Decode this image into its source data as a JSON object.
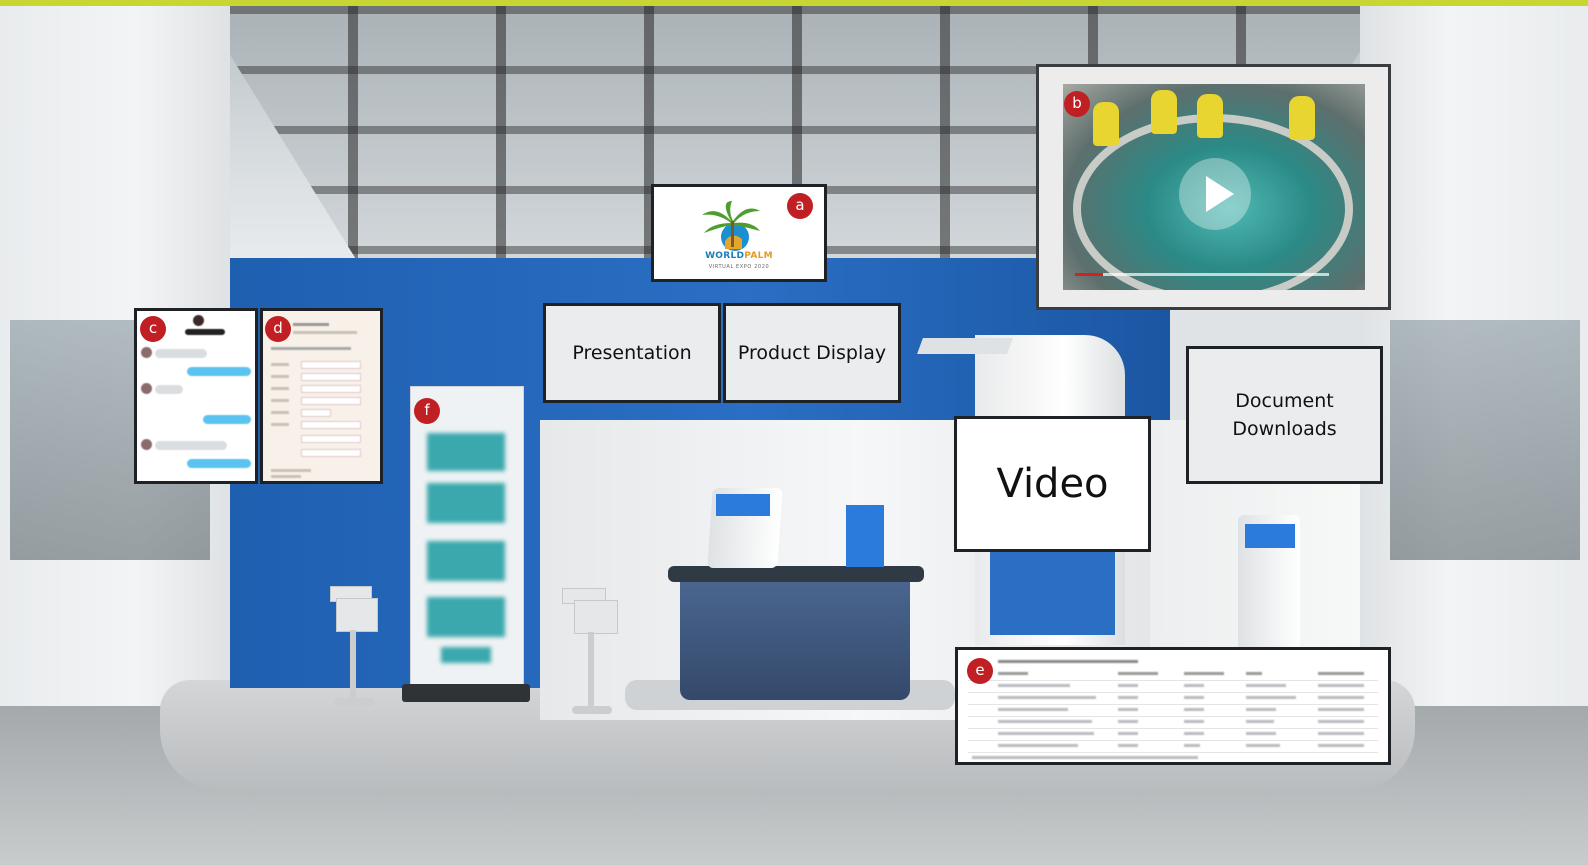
{
  "booth": {
    "panels": {
      "presentation": "Presentation",
      "product_display": "Product Display",
      "video": "Video",
      "document_downloads": "Document\nDownloads"
    },
    "logo": {
      "name_part1": "WORLD",
      "name_part2": "PALM",
      "tagline": "VIRTUAL EXPO 2020"
    }
  },
  "markers": {
    "a": "a",
    "b": "b",
    "c": "c",
    "d": "d",
    "e": "e",
    "f": "f"
  },
  "video_player": {
    "progress_fraction": 0.11
  },
  "colors": {
    "accent_bar": "#c8d634",
    "booth_blue": "#2a6fc4",
    "marker_red": "#c01f24"
  },
  "icons": {
    "play": "play-icon"
  }
}
